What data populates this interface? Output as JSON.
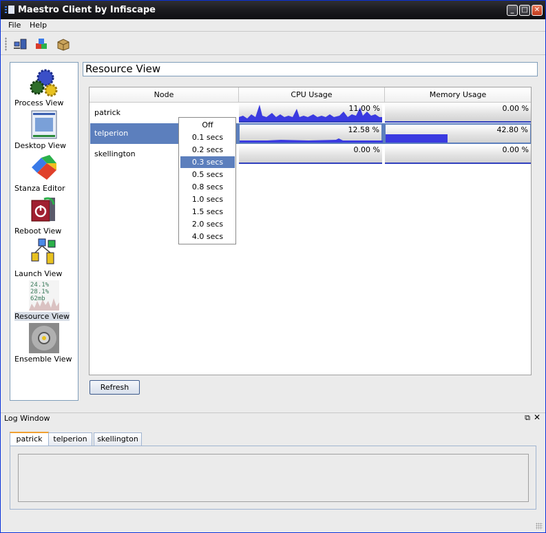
{
  "window": {
    "title": "Maestro Client by Infiscape"
  },
  "menu": {
    "items": [
      "File",
      "Help"
    ]
  },
  "toolbar": {
    "icons": [
      "network-computers-icon",
      "cubes-icon",
      "package-icon"
    ]
  },
  "sidebar": {
    "items": [
      {
        "label": "Process View",
        "icon": "gears-icon"
      },
      {
        "label": "Desktop View",
        "icon": "desktop-screenshot-icon"
      },
      {
        "label": "Stanza Editor",
        "icon": "stanza-editor-icon"
      },
      {
        "label": "Reboot View",
        "icon": "reboot-icon"
      },
      {
        "label": "Launch View",
        "icon": "launch-icon"
      },
      {
        "label": "Resource View",
        "icon": "resource-icon",
        "icon_text": [
          "24.1%",
          "28.1%",
          "62mb"
        ]
      },
      {
        "label": "Ensemble View",
        "icon": "ensemble-icon"
      }
    ],
    "selected": "Resource View"
  },
  "main": {
    "title": "Resource View",
    "columns": [
      "Node",
      "CPU Usage",
      "Memory Usage"
    ],
    "rows": [
      {
        "node": "patrick",
        "cpu": "11.00 %",
        "mem": "0.00 %",
        "mem_fraction": 0.0
      },
      {
        "node": "telperion",
        "cpu": "12.58 %",
        "mem": "42.80 %",
        "mem_fraction": 0.428
      },
      {
        "node": "skellington",
        "cpu": "0.00 %",
        "mem": "0.00 %",
        "mem_fraction": 0.0
      }
    ],
    "selected_row": "telperion",
    "refresh_label": "Refresh",
    "interval_menu": {
      "options": [
        "Off",
        "0.1 secs",
        "0.2 secs",
        "0.3 secs",
        "0.5 secs",
        "0.8 secs",
        "1.0 secs",
        "1.5 secs",
        "2.0 secs",
        "4.0 secs"
      ],
      "selected": "0.3 secs"
    }
  },
  "log": {
    "title": "Log Window",
    "tabs": [
      "patrick",
      "telperion",
      "skellington"
    ],
    "active_tab": "patrick"
  },
  "colors": {
    "selection": "#5c7fbd",
    "graph": "#3a3ae0",
    "titlebar": "#1b1b1f"
  }
}
